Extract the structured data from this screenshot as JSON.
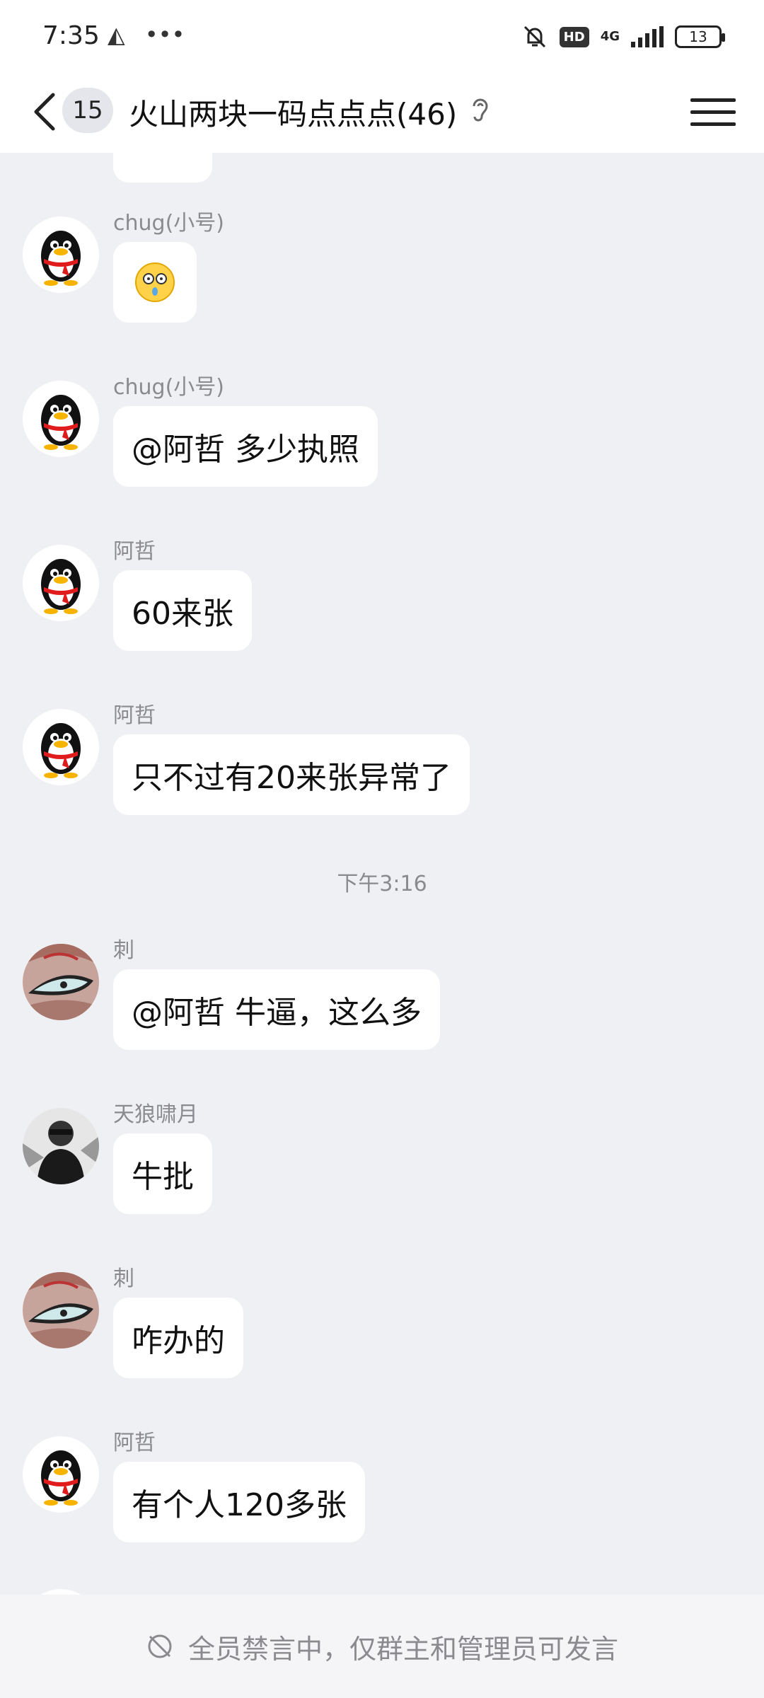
{
  "status_bar": {
    "time": "7:35",
    "hd": "HD",
    "network": "4G",
    "battery": "13"
  },
  "header": {
    "unread_count": "15",
    "title": "火山两块一码点点点(46)"
  },
  "messages": [
    {
      "sender": "chug(小号)",
      "text": "",
      "avatar": "penguin-avatar",
      "emoji": "shocked-face"
    },
    {
      "sender": "chug(小号)",
      "text": "@阿哲 多少执照",
      "avatar": "penguin-avatar"
    },
    {
      "sender": "阿哲",
      "text": "60来张",
      "avatar": "penguin-avatar"
    },
    {
      "sender": "阿哲",
      "text": "只不过有20来张异常了",
      "avatar": "penguin-avatar"
    },
    {
      "sender": "刺",
      "text": "@阿哲 牛逼，这么多",
      "avatar": "eye-avatar"
    },
    {
      "sender": "天狼啸月",
      "text": "牛批",
      "avatar": "photo-avatar"
    },
    {
      "sender": "刺",
      "text": "咋办的",
      "avatar": "eye-avatar"
    },
    {
      "sender": "阿哲",
      "text": "有个人120多张",
      "avatar": "penguin-avatar"
    }
  ],
  "time_separator": "下午3:16",
  "bottom_notice": "全员禁言中，仅群主和管理员可发言",
  "colors": {
    "chat_background": "#eff0f3",
    "bubble": "#ffffff",
    "sender_text": "#8a8a8f",
    "header_background": "#ffffff"
  }
}
